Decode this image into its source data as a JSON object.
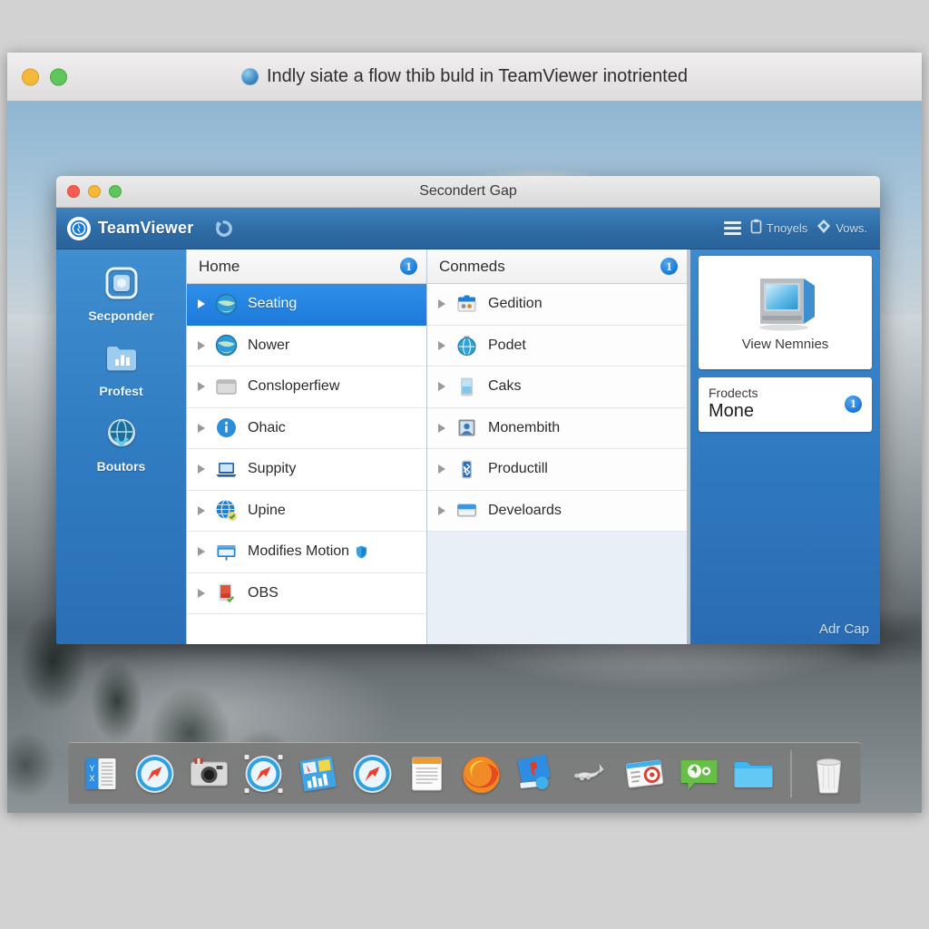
{
  "outer_window": {
    "title": "Indly siate a flow thib buld in TeamViewer inotriented",
    "traffic_lights": [
      "yellow",
      "green"
    ],
    "title_icon": "globe-icon"
  },
  "tv_window": {
    "title": "Secondert Gap",
    "traffic_lights": [
      "red",
      "yellow",
      "green"
    ],
    "toolbar": {
      "brand": "TeamViewer",
      "refresh_icon": "refresh-circle-icon",
      "right_items": [
        {
          "icon": "list-view-icon",
          "label": ""
        },
        {
          "icon": "clipboard-icon",
          "label": "Tnoyels"
        },
        {
          "icon": "diamond-icon",
          "label": "Vows."
        }
      ]
    },
    "sidebar": {
      "items": [
        {
          "label": "Secponder",
          "icon": "remote-control-icon"
        },
        {
          "label": "Profest",
          "icon": "chart-folder-icon"
        },
        {
          "label": "Boutors",
          "icon": "network-globe-icon"
        }
      ]
    },
    "columns": [
      {
        "header": "Home",
        "badge": "1",
        "rows": [
          {
            "label": "Seating",
            "icon": "globe-clock-icon",
            "state": "selected"
          },
          {
            "label": "Nower",
            "icon": "globe-clock-icon",
            "state": "normal"
          },
          {
            "label": "Consloperfiew",
            "icon": "window-gray-icon",
            "state": "normal"
          },
          {
            "label": "Ohaic",
            "icon": "info-circle-icon",
            "state": "normal"
          },
          {
            "label": "Suppity",
            "icon": "laptop-icon",
            "state": "normal"
          },
          {
            "label": "Upine",
            "icon": "globe-grid-icon",
            "state": "normal"
          },
          {
            "label": "Modifies Motion",
            "icon": "monitor-blue-icon",
            "state": "normal",
            "badge_icon": "shield-badge-icon"
          },
          {
            "label": "OBS",
            "icon": "record-app-icon",
            "state": "normal"
          }
        ]
      },
      {
        "header": "Conmeds",
        "badge": "1",
        "rows": [
          {
            "label": "Gedition",
            "icon": "toolbox-icon",
            "state": "soft-selected"
          },
          {
            "label": "Podet",
            "icon": "globe-pin-icon",
            "state": "normal"
          },
          {
            "label": "Caks",
            "icon": "tablet-icon",
            "state": "normal"
          },
          {
            "label": "Monembith",
            "icon": "contact-card-icon",
            "state": "normal"
          },
          {
            "label": "Productill",
            "icon": "bluetooth-device-icon",
            "state": "normal"
          },
          {
            "label": "Develoards",
            "icon": "window-blue-icon",
            "state": "normal"
          }
        ]
      }
    ],
    "right_panel": {
      "view_card": {
        "label": "View Nemnies",
        "icon": "crt-monitor-icon"
      },
      "products_card": {
        "title": "Frodects",
        "value": "Mone",
        "badge": "1"
      },
      "footer_label": "Adr Cap"
    }
  },
  "dock": {
    "items": [
      {
        "name": "dock-pages-icon"
      },
      {
        "name": "dock-safari-icon"
      },
      {
        "name": "dock-camera-icon"
      },
      {
        "name": "dock-safari-2-icon"
      },
      {
        "name": "dock-keynote-icon"
      },
      {
        "name": "dock-safari-3-icon"
      },
      {
        "name": "dock-textedit-icon"
      },
      {
        "name": "dock-firefox-icon"
      },
      {
        "name": "dock-presentation-icon"
      },
      {
        "name": "dock-pointer-icon"
      },
      {
        "name": "dock-news-icon"
      },
      {
        "name": "dock-messages-icon"
      },
      {
        "name": "dock-folder-icon"
      },
      {
        "name": "dock-trash-icon"
      }
    ]
  },
  "colors": {
    "tv_blue": "#2e77bf",
    "selection_blue": "#1d7ada",
    "badge_blue": "#1878d6",
    "dock_gray": "#7c7c7c"
  }
}
